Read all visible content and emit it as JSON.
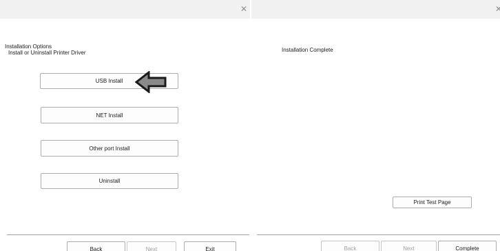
{
  "left": {
    "close_icon": "✕",
    "title": "Installation Options",
    "subtitle": "Install or Uninstall Printer Driver",
    "options": [
      {
        "label": "USB Install"
      },
      {
        "label": "NET Install"
      },
      {
        "label": "Other port Install"
      },
      {
        "label": "Uninstall"
      }
    ],
    "annotation_icon": "left-arrow-icon",
    "annotation_color": "#8a8a8a",
    "footer": {
      "back": "Back",
      "next": "Next",
      "exit": "Exit"
    }
  },
  "right": {
    "close_icon": "✕",
    "title": "Installation Complete",
    "print_test_page": "Print Test Page",
    "footer": {
      "back": "Back",
      "next": "Next",
      "complete": "Complete"
    }
  }
}
